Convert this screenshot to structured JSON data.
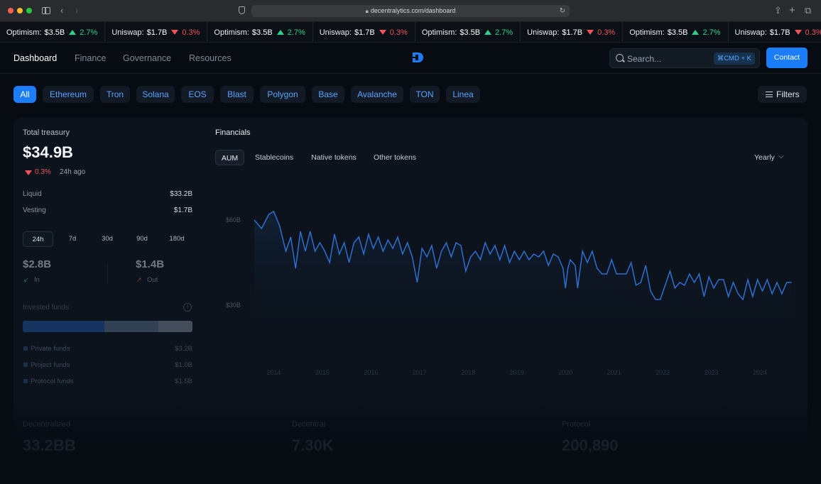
{
  "browser": {
    "url": "decentralytics.com/dashboard"
  },
  "ticker": [
    {
      "name": "Optimism:",
      "value": "$3.5B",
      "change": "2.7%",
      "direction": "up"
    },
    {
      "name": "Uniswap:",
      "value": "$1.7B",
      "change": "0.3%",
      "direction": "down"
    },
    {
      "name": "Optimism:",
      "value": "$3.5B",
      "change": "2.7%",
      "direction": "up"
    },
    {
      "name": "Uniswap:",
      "value": "$1.7B",
      "change": "0.3%",
      "direction": "down"
    },
    {
      "name": "Optimism:",
      "value": "$3.5B",
      "change": "2.7%",
      "direction": "up"
    },
    {
      "name": "Uniswap:",
      "value": "$1.7B",
      "change": "0.3%",
      "direction": "down"
    },
    {
      "name": "Optimism:",
      "value": "$3.5B",
      "change": "2.7%",
      "direction": "up"
    },
    {
      "name": "Uniswap:",
      "value": "$1.7B",
      "change": "0.3%",
      "direction": "down"
    },
    {
      "name": "Op",
      "value": "",
      "change": "",
      "direction": "none"
    }
  ],
  "nav": {
    "links": [
      "Dashboard",
      "Finance",
      "Governance",
      "Resources"
    ],
    "active": "Dashboard",
    "search_placeholder": "Search...",
    "search_shortcut": "⌘CMD + K",
    "contact_label": "Contact"
  },
  "chains": {
    "items": [
      "All",
      "Ethereum",
      "Tron",
      "Solana",
      "EOS",
      "Blast",
      "Polygon",
      "Base",
      "Avalanche",
      "TON",
      "Linea"
    ],
    "active": "All",
    "filters_label": "Filters"
  },
  "treasury": {
    "title": "Total treasury",
    "total": "$34.9B",
    "change": "0.3%",
    "change_direction": "down",
    "period": "24h ago",
    "liquid_label": "Liquid",
    "liquid_value": "$33.2B",
    "vesting_label": "Vesting",
    "vesting_value": "$1.7B",
    "ranges": [
      "24h",
      "7d",
      "30d",
      "90d",
      "180d"
    ],
    "active_range": "24h",
    "in_value": "$2.8B",
    "in_label": "In",
    "out_value": "$1.4B",
    "out_label": "Out",
    "invested_label": "Invested funds",
    "funds": [
      {
        "label": "Private funds",
        "value": "$3.2B",
        "share": 0.48,
        "color": "#173a6b"
      },
      {
        "label": "Project funds",
        "value": "$1.0B",
        "share": 0.32,
        "color": "#3a4a5e"
      },
      {
        "label": "Protocol funds",
        "value": "$1.5B",
        "share": 0.2,
        "color": "#4d5866"
      }
    ]
  },
  "financials": {
    "title": "Financials",
    "tabs": [
      "AUM",
      "Stablecoins",
      "Native tokens",
      "Other tokens"
    ],
    "active_tab": "AUM",
    "period_select": "Yearly"
  },
  "chart_data": {
    "type": "area",
    "title": "",
    "xlabel": "",
    "ylabel": "",
    "y_ticks": [
      "$60B",
      "$30B"
    ],
    "x_ticks": [
      "2014",
      "2015",
      "2016",
      "2017",
      "2018",
      "2019",
      "2020",
      "2021",
      "2022",
      "2023",
      "2024"
    ],
    "ylim": [
      0,
      75
    ],
    "x_range": [
      2013.6,
      2024.7
    ],
    "grid": false,
    "line_color": "#2f6fd1",
    "series": [
      {
        "values": [
          [
            2013.6,
            60
          ],
          [
            2013.75,
            57
          ],
          [
            2013.9,
            62
          ],
          [
            2014.0,
            63
          ],
          [
            2014.12,
            58
          ],
          [
            2014.25,
            49
          ],
          [
            2014.35,
            54
          ],
          [
            2014.45,
            43
          ],
          [
            2014.55,
            56
          ],
          [
            2014.65,
            49
          ],
          [
            2014.75,
            56
          ],
          [
            2014.85,
            49
          ],
          [
            2014.95,
            52
          ],
          [
            2015.05,
            49
          ],
          [
            2015.15,
            45
          ],
          [
            2015.25,
            55
          ],
          [
            2015.35,
            48
          ],
          [
            2015.45,
            52
          ],
          [
            2015.55,
            45
          ],
          [
            2015.65,
            52
          ],
          [
            2015.75,
            54
          ],
          [
            2015.85,
            48
          ],
          [
            2015.95,
            55
          ],
          [
            2016.05,
            50
          ],
          [
            2016.15,
            54
          ],
          [
            2016.25,
            49
          ],
          [
            2016.35,
            53
          ],
          [
            2016.45,
            50
          ],
          [
            2016.55,
            54
          ],
          [
            2016.65,
            48
          ],
          [
            2016.75,
            52
          ],
          [
            2016.85,
            47
          ],
          [
            2016.95,
            38
          ],
          [
            2017.05,
            50
          ],
          [
            2017.15,
            47
          ],
          [
            2017.25,
            51
          ],
          [
            2017.35,
            43
          ],
          [
            2017.45,
            49
          ],
          [
            2017.55,
            52
          ],
          [
            2017.65,
            47
          ],
          [
            2017.75,
            52
          ],
          [
            2017.85,
            51
          ],
          [
            2017.95,
            42
          ],
          [
            2018.05,
            47
          ],
          [
            2018.15,
            49
          ],
          [
            2018.25,
            46
          ],
          [
            2018.35,
            52
          ],
          [
            2018.45,
            48
          ],
          [
            2018.55,
            51
          ],
          [
            2018.65,
            46
          ],
          [
            2018.75,
            51
          ],
          [
            2018.85,
            45
          ],
          [
            2018.95,
            49
          ],
          [
            2019.05,
            46
          ],
          [
            2019.15,
            49
          ],
          [
            2019.25,
            46
          ],
          [
            2019.35,
            48
          ],
          [
            2019.45,
            47
          ],
          [
            2019.55,
            49
          ],
          [
            2019.65,
            44
          ],
          [
            2019.75,
            48
          ],
          [
            2019.85,
            47
          ],
          [
            2019.95,
            43
          ],
          [
            2020.0,
            36
          ],
          [
            2020.05,
            43
          ],
          [
            2020.1,
            46
          ],
          [
            2020.2,
            44
          ],
          [
            2020.25,
            36
          ],
          [
            2020.35,
            49
          ],
          [
            2020.45,
            45
          ],
          [
            2020.55,
            49
          ],
          [
            2020.65,
            43
          ],
          [
            2020.75,
            41
          ],
          [
            2020.85,
            41
          ],
          [
            2020.95,
            46
          ],
          [
            2021.05,
            41
          ],
          [
            2021.15,
            41
          ],
          [
            2021.25,
            41
          ],
          [
            2021.35,
            45
          ],
          [
            2021.45,
            37
          ],
          [
            2021.55,
            38
          ],
          [
            2021.65,
            44
          ],
          [
            2021.75,
            35
          ],
          [
            2021.85,
            32
          ],
          [
            2021.95,
            32
          ],
          [
            2022.05,
            37
          ],
          [
            2022.15,
            42
          ],
          [
            2022.25,
            36
          ],
          [
            2022.35,
            38
          ],
          [
            2022.45,
            37
          ],
          [
            2022.55,
            41
          ],
          [
            2022.65,
            38
          ],
          [
            2022.75,
            41
          ],
          [
            2022.85,
            33
          ],
          [
            2022.95,
            40
          ],
          [
            2023.05,
            36
          ],
          [
            2023.15,
            39
          ],
          [
            2023.25,
            39
          ],
          [
            2023.35,
            33
          ],
          [
            2023.45,
            38
          ],
          [
            2023.55,
            34
          ],
          [
            2023.65,
            32
          ],
          [
            2023.75,
            39
          ],
          [
            2023.85,
            33
          ],
          [
            2023.95,
            39
          ],
          [
            2024.05,
            35
          ],
          [
            2024.15,
            39
          ],
          [
            2024.25,
            34
          ],
          [
            2024.35,
            38
          ],
          [
            2024.45,
            34
          ],
          [
            2024.55,
            38
          ],
          [
            2024.65,
            38
          ]
        ]
      }
    ]
  },
  "bottom": [
    {
      "label": "Decentralized",
      "value": "33.2BB"
    },
    {
      "label": "Decentral",
      "value": "7.30K"
    },
    {
      "label": "Protocol",
      "value": "200,890"
    }
  ]
}
